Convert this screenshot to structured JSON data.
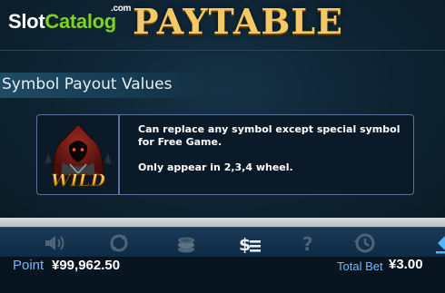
{
  "watermark": {
    "slot": "Slot",
    "catalog": "Catalog",
    "com": ".com"
  },
  "header": {
    "title": "PAYTABLE"
  },
  "section": {
    "title": "Symbol Payout Values"
  },
  "wild_card": {
    "symbol_icon": "wild-hooded-figure-icon",
    "symbol_text": "WILD",
    "description_1": "Can replace any symbol except special symbol for Free Game.",
    "description_2": "Only appear in 2,3,4 wheel."
  },
  "toolbar": {
    "icons": [
      "sound-icon",
      "autoplay-icon",
      "coins-icon",
      "paytable-icon",
      "help-icon",
      "history-icon",
      "back-arrow-icon"
    ]
  },
  "status": {
    "point_label": "Point",
    "point_value": "¥99,962.50",
    "total_bet_label": "Total Bet",
    "total_bet_value": "¥3.00"
  },
  "colors": {
    "title_gold": "#f3c866",
    "label_blue": "#74b9ff",
    "watermark_green": "#7ed321",
    "card_border": "#5e6fa0"
  }
}
